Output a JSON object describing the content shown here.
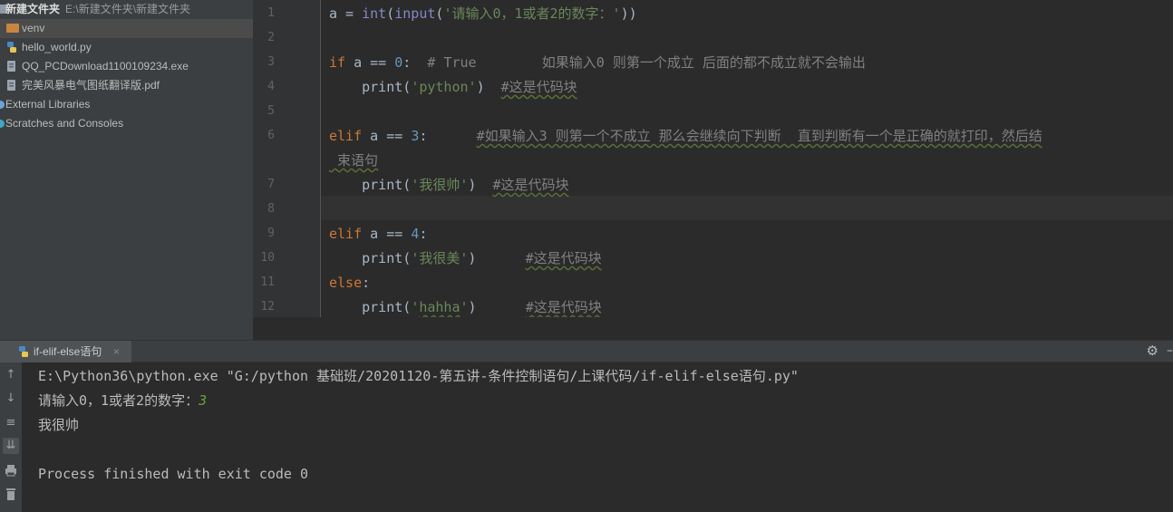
{
  "sidebar": {
    "project": {
      "name": "新建文件夹",
      "path": "E:\\新建文件夹\\新建文件夹"
    },
    "items": [
      {
        "label": "venv",
        "icon": "folder-icon",
        "selected": true
      },
      {
        "label": "hello_world.py",
        "icon": "python-file-icon"
      },
      {
        "label": "QQ_PCDownload1100109234.exe",
        "icon": "exe-file-icon"
      },
      {
        "label": "完美风暴电气图纸翻译版.pdf",
        "icon": "pdf-file-icon"
      },
      {
        "label": "External Libraries",
        "icon": "library-icon"
      },
      {
        "label": "Scratches and Consoles",
        "icon": "scratch-icon"
      }
    ]
  },
  "editor": {
    "line_numbers": [
      "1",
      "2",
      "3",
      "4",
      "5",
      "6",
      "7",
      "8",
      "9",
      "10",
      "11",
      "12"
    ],
    "current_line": 8,
    "lines": [
      {
        "segments": [
          [
            "",
            "a = "
          ],
          [
            "builtin",
            "int"
          ],
          [
            "",
            "("
          ],
          [
            "builtin",
            "input"
          ],
          [
            "",
            "("
          ],
          [
            "str",
            "'请输入0，1或者2的数字：'"
          ],
          [
            "",
            "))"
          ]
        ]
      },
      {
        "segments": []
      },
      {
        "segments": [
          [
            "kw",
            "if"
          ],
          [
            "",
            " a == "
          ],
          [
            "num",
            "0"
          ],
          [
            "",
            ":  "
          ],
          [
            "cmt",
            "# True        如果输入0 则第一个成立 后面的都不成立就不会输出"
          ]
        ]
      },
      {
        "segments": [
          [
            "",
            "    print("
          ],
          [
            "str",
            "'python'"
          ],
          [
            "",
            ")  "
          ],
          [
            "cmt-u",
            "#这是代码块"
          ]
        ]
      },
      {
        "segments": []
      },
      {
        "segments": [
          [
            "kw",
            "elif"
          ],
          [
            "",
            " a == "
          ],
          [
            "num",
            "3"
          ],
          [
            "",
            ":      "
          ],
          [
            "cmt-u",
            "#如果输入3 则第一个不成立 那么会继续向下判断  直到判断有一个是正确的就打印，然后结"
          ]
        ]
      },
      {
        "segments": [
          [
            "cmt-u",
            " 束语句"
          ]
        ]
      },
      {
        "segments": [
          [
            "",
            "    print("
          ],
          [
            "str",
            "'我很帅'"
          ],
          [
            "",
            ")  "
          ],
          [
            "cmt-u",
            "#这是代码块"
          ]
        ]
      },
      {
        "segments": []
      },
      {
        "segments": [
          [
            "kw",
            "elif"
          ],
          [
            "",
            " a == "
          ],
          [
            "num",
            "4"
          ],
          [
            "",
            ":"
          ]
        ]
      },
      {
        "segments": [
          [
            "",
            "    print("
          ],
          [
            "str",
            "'我很美'"
          ],
          [
            "",
            ")      "
          ],
          [
            "cmt-u",
            "#这是代码块"
          ]
        ]
      },
      {
        "segments": [
          [
            "kw",
            "else"
          ],
          [
            "",
            ":"
          ]
        ]
      },
      {
        "segments": [
          [
            "",
            "    print("
          ],
          [
            "str",
            "'"
          ],
          [
            "str-u",
            "hahha"
          ],
          [
            "str",
            "'"
          ],
          [
            "",
            ")      "
          ],
          [
            "cmt-u",
            "#这是代码块"
          ]
        ]
      }
    ]
  },
  "run": {
    "tab_label": "if-elif-else语句",
    "tab_close": "×",
    "output": [
      {
        "text": "E:\\Python36\\python.exe \"G:/python 基础班/20201120-第五讲-条件控制语句/上课代码/if-elif-else语句.py\""
      },
      {
        "text": "请输入0，1或者2的数字：",
        "input": "3"
      },
      {
        "text": "我很帅"
      },
      {
        "text": ""
      },
      {
        "text": "Process finished with exit code 0"
      }
    ]
  },
  "colors": {
    "keyword": "#cc7832",
    "number": "#6897bb",
    "string": "#6a8759",
    "comment": "#808080",
    "user_input": "#62a337"
  }
}
